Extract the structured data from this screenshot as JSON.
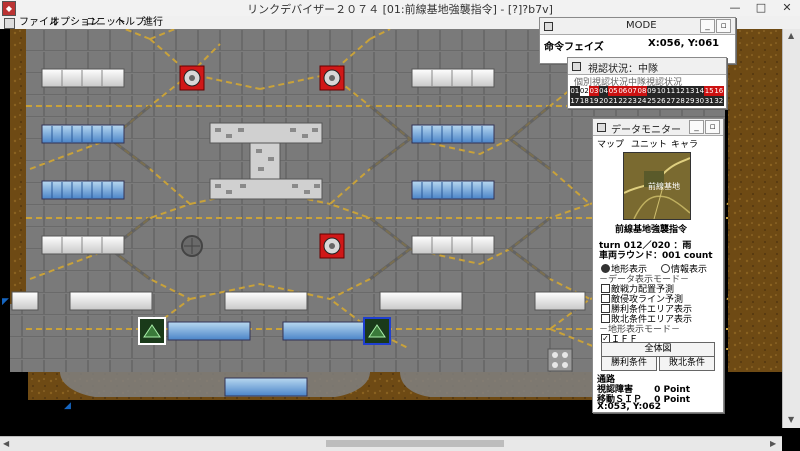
{
  "window": {
    "title": "リンクデバイザー２０７４ [01:前線基地強襲指令] - [?]?b7v]",
    "app_icon": "app-icon"
  },
  "menu": [
    "ファイル",
    "オプション",
    "ユニット",
    "ヘルプ",
    "進行"
  ],
  "mode_panel": {
    "title": "MODE",
    "phase": "命令フェイズ",
    "coord": "X:056, Y:061"
  },
  "vision_panel": {
    "title": "視認状況：中隊",
    "tabs": [
      "個別視認状況",
      "中隊視認状況"
    ],
    "turns_row1": [
      "01",
      "02",
      "03",
      "04",
      "05",
      "06",
      "07",
      "08",
      "09",
      "10",
      "11",
      "12",
      "13",
      "14",
      "15",
      "16"
    ],
    "turns_row2": [
      "17",
      "18",
      "19",
      "20",
      "21",
      "22",
      "23",
      "24",
      "25",
      "26",
      "27",
      "28",
      "29",
      "30",
      "31",
      "32"
    ],
    "active_turn": "02",
    "red_turns": [
      "03",
      "05",
      "06",
      "07",
      "08",
      "15",
      "16"
    ],
    "colors": {
      "active": "#ffffff",
      "red": "#cc1111",
      "dark": "#262626"
    }
  },
  "data_monitor": {
    "title": "データモニター",
    "tabs": [
      "マップ",
      "ユニット",
      "キャラ"
    ],
    "minimap_label": "前線基地",
    "mission": "前線基地強襲指令",
    "turn_line": "turn 012／020 ：雨",
    "round_line": "車両ラウンド：001 count",
    "radio_terrain": "地形表示",
    "radio_info": "情報表示",
    "data_mode_label": "データ表示モード",
    "options": [
      "敵戦力配置予測",
      "敵侵攻ライン予測",
      "勝利条件エリア表示",
      "敗北条件エリア表示"
    ],
    "terrain_mode_label": "地形表示モード",
    "iff_label": "ＩＦＦ",
    "overview_button": "全体図",
    "win_button": "勝利条件",
    "lose_button": "敗北条件",
    "terrain_name": "通路",
    "vision_obstacle": "視認障害　　 0 Point",
    "move_sip": "移動ＳＩＰ　 0 Point",
    "coord": "X:053, Y:062"
  }
}
